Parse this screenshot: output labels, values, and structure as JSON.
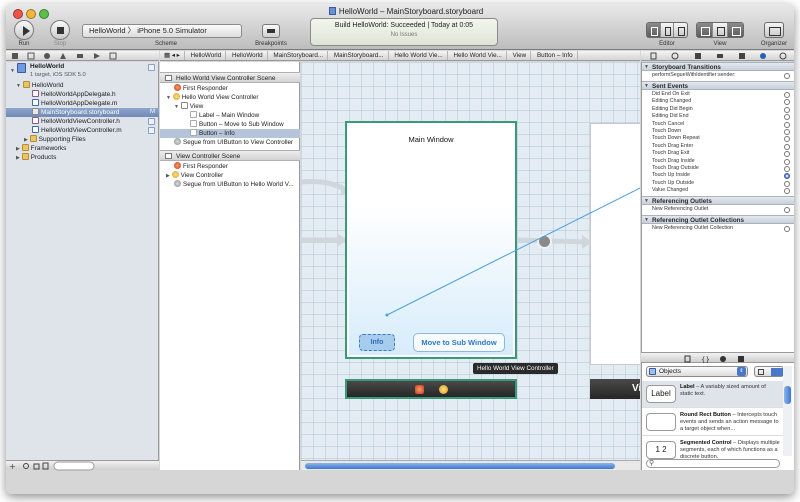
{
  "window": {
    "title": "HelloWorld – MainStoryboard.storyboard",
    "traffic_lights": [
      "close",
      "minimize",
      "zoom"
    ],
    "colors": {
      "close": "#f0534a",
      "minimize": "#f3b63b",
      "zoom": "#5cc04a"
    }
  },
  "toolbar": {
    "run_label": "Run",
    "stop_label": "Stop",
    "scheme_label": "Scheme",
    "scheme_value": "HelloWorld 〉 iPhone 5.0 Simulator",
    "breakpoints_label": "Breakpoints",
    "activity_line1": "Build HelloWorld: Succeeded  |  Today at 0:05",
    "activity_line2": "No Issues",
    "editor_label": "Editor",
    "view_label": "View",
    "organizer_label": "Organizer"
  },
  "jumpbar": {
    "crumbs": [
      "HelloWorld",
      "HelloWorld",
      "MainStoryboard...",
      "MainStoryboard...",
      "Hello World Vie...",
      "Hello World Vie...",
      "View",
      "Button – Info"
    ]
  },
  "navigator": {
    "items": [
      {
        "label": "HelloWorld",
        "sub": "1 target, iOS SDK 5.0",
        "icon": "project-icon"
      },
      {
        "label": "HelloWorld",
        "icon": "folder-icon"
      },
      {
        "label": "HelloWorldAppDelegate.h",
        "icon": "header-file-icon"
      },
      {
        "label": "HelloWorldAppDelegate.m",
        "icon": "implementation-file-icon"
      },
      {
        "label": "MainStoryboard.storyboard",
        "icon": "storyboard-file-icon",
        "status": "M"
      },
      {
        "label": "HelloWorldViewController.h",
        "icon": "header-file-icon"
      },
      {
        "label": "HelloWorldViewController.m",
        "icon": "implementation-file-icon"
      },
      {
        "label": "Supporting Files",
        "icon": "folder-icon"
      },
      {
        "label": "Frameworks",
        "icon": "folder-icon"
      },
      {
        "label": "Products",
        "icon": "folder-icon"
      }
    ]
  },
  "outline": {
    "scene1_title": "Hello World View Controller Scene",
    "scene1_items": [
      "First Responder",
      "Hello World View Controller",
      "View",
      "Label – Main Window",
      "Button – Move to Sub Window",
      "Button – Info",
      "Segue from UIButton to View Controller"
    ],
    "scene2_title": "View Controller Scene",
    "scene2_items": [
      "First Responder",
      "View Controller",
      "Segue from UIButton to Hello World V..."
    ]
  },
  "canvas": {
    "main_label": "Main Window",
    "info_button": "Info",
    "move_button": "Move to Sub Window",
    "tooltip": "Hello World View Controller",
    "second_dock_text": "Vi"
  },
  "inspector": {
    "storyboard_transitions_header": "Storyboard Transitions",
    "storyboard_transitions": [
      "performSegueWithIdentifier:sender:"
    ],
    "sent_events_header": "Sent Events",
    "sent_events": [
      "Did End On Exit",
      "Editing Changed",
      "Editing Did Begin",
      "Editing Did End",
      "Touch Cancel",
      "Touch Down",
      "Touch Down Repeat",
      "Touch Drag Enter",
      "Touch Drag Exit",
      "Touch Drag Inside",
      "Touch Drag Outside",
      "Touch Up Inside",
      "Touch Up Outside",
      "Value Changed"
    ],
    "referencing_outlets_header": "Referencing Outlets",
    "referencing_outlets": [
      "New Referencing Outlet"
    ],
    "referencing_outlet_collections_header": "Referencing Outlet Collections",
    "referencing_outlet_collections": [
      "New Referencing Outlet Collection"
    ]
  },
  "library": {
    "selector": "Objects",
    "items": [
      {
        "thumb": "Label",
        "title": "Label",
        "desc": " – A variably sized amount of static text."
      },
      {
        "thumb": "",
        "title": "Round Rect Button",
        "desc": " – Intercepts touch events and sends an action message to a target object when..."
      },
      {
        "thumb": "1 2",
        "title": "Segmented Control",
        "desc": " – Displays multiple segments, each of which functions as a discrete button."
      }
    ]
  },
  "colors": {
    "selection": "#6f8ab7",
    "scene_border": "#3a9a78",
    "connection_line": "#4aa0e0"
  }
}
